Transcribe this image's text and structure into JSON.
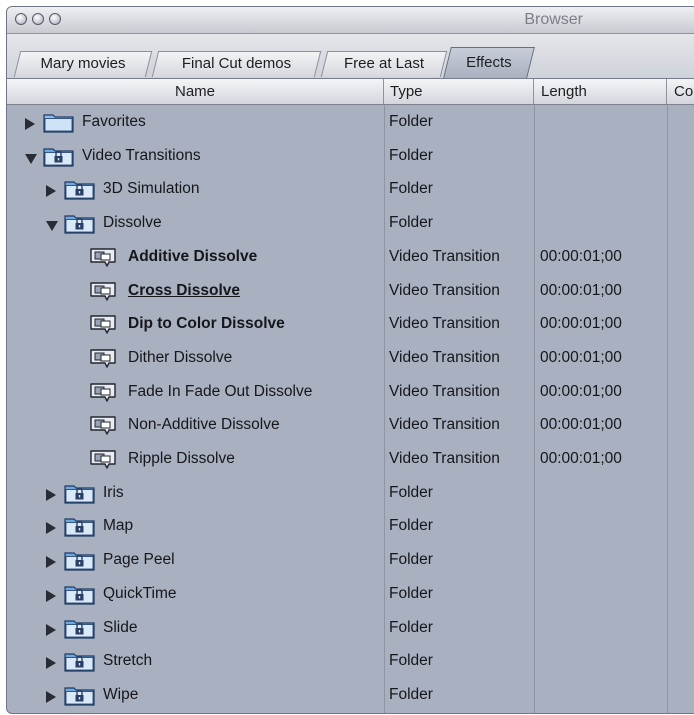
{
  "window": {
    "title": "Browser"
  },
  "tabs": [
    {
      "label": "Mary movies",
      "active": false
    },
    {
      "label": "Final Cut demos",
      "active": false
    },
    {
      "label": "Free at Last",
      "active": false
    },
    {
      "label": "Effects",
      "active": true
    }
  ],
  "columns": {
    "name": "Name",
    "type": "Type",
    "length": "Length",
    "more": "Co"
  },
  "rows": [
    {
      "name": "Favorites",
      "type": "Folder",
      "length": "",
      "level": 0,
      "disclosure": "collapsed",
      "icon": "folder-icon",
      "bold": false,
      "underline": false
    },
    {
      "name": "Video Transitions",
      "type": "Folder",
      "length": "",
      "level": 0,
      "disclosure": "expanded",
      "icon": "locked-folder-icon",
      "bold": false,
      "underline": false
    },
    {
      "name": "3D Simulation",
      "type": "Folder",
      "length": "",
      "level": 1,
      "disclosure": "collapsed",
      "icon": "locked-folder-icon",
      "bold": false,
      "underline": false
    },
    {
      "name": "Dissolve",
      "type": "Folder",
      "length": "",
      "level": 1,
      "disclosure": "expanded",
      "icon": "locked-folder-icon",
      "bold": false,
      "underline": false
    },
    {
      "name": "Additive Dissolve",
      "type": "Video Transition",
      "length": "00:00:01;00",
      "level": 2,
      "disclosure": "none",
      "icon": "transition-icon",
      "bold": true,
      "underline": false
    },
    {
      "name": "Cross Dissolve",
      "type": "Video Transition",
      "length": "00:00:01;00",
      "level": 2,
      "disclosure": "none",
      "icon": "transition-icon",
      "bold": true,
      "underline": true
    },
    {
      "name": "Dip to Color Dissolve",
      "type": "Video Transition",
      "length": "00:00:01;00",
      "level": 2,
      "disclosure": "none",
      "icon": "transition-icon",
      "bold": true,
      "underline": false
    },
    {
      "name": "Dither Dissolve",
      "type": "Video Transition",
      "length": "00:00:01;00",
      "level": 2,
      "disclosure": "none",
      "icon": "transition-icon",
      "bold": false,
      "underline": false
    },
    {
      "name": "Fade In Fade Out Dissolve",
      "type": "Video Transition",
      "length": "00:00:01;00",
      "level": 2,
      "disclosure": "none",
      "icon": "transition-icon",
      "bold": false,
      "underline": false
    },
    {
      "name": "Non-Additive Dissolve",
      "type": "Video Transition",
      "length": "00:00:01;00",
      "level": 2,
      "disclosure": "none",
      "icon": "transition-icon",
      "bold": false,
      "underline": false
    },
    {
      "name": "Ripple Dissolve",
      "type": "Video Transition",
      "length": "00:00:01;00",
      "level": 2,
      "disclosure": "none",
      "icon": "transition-icon",
      "bold": false,
      "underline": false
    },
    {
      "name": "Iris",
      "type": "Folder",
      "length": "",
      "level": 1,
      "disclosure": "collapsed",
      "icon": "locked-folder-icon",
      "bold": false,
      "underline": false
    },
    {
      "name": "Map",
      "type": "Folder",
      "length": "",
      "level": 1,
      "disclosure": "collapsed",
      "icon": "locked-folder-icon",
      "bold": false,
      "underline": false
    },
    {
      "name": "Page Peel",
      "type": "Folder",
      "length": "",
      "level": 1,
      "disclosure": "collapsed",
      "icon": "locked-folder-icon",
      "bold": false,
      "underline": false
    },
    {
      "name": "QuickTime",
      "type": "Folder",
      "length": "",
      "level": 1,
      "disclosure": "collapsed",
      "icon": "locked-folder-icon",
      "bold": false,
      "underline": false
    },
    {
      "name": "Slide",
      "type": "Folder",
      "length": "",
      "level": 1,
      "disclosure": "collapsed",
      "icon": "locked-folder-icon",
      "bold": false,
      "underline": false
    },
    {
      "name": "Stretch",
      "type": "Folder",
      "length": "",
      "level": 1,
      "disclosure": "collapsed",
      "icon": "locked-folder-icon",
      "bold": false,
      "underline": false
    },
    {
      "name": "Wipe",
      "type": "Folder",
      "length": "",
      "level": 1,
      "disclosure": "collapsed",
      "icon": "locked-folder-icon",
      "bold": false,
      "underline": false
    }
  ]
}
